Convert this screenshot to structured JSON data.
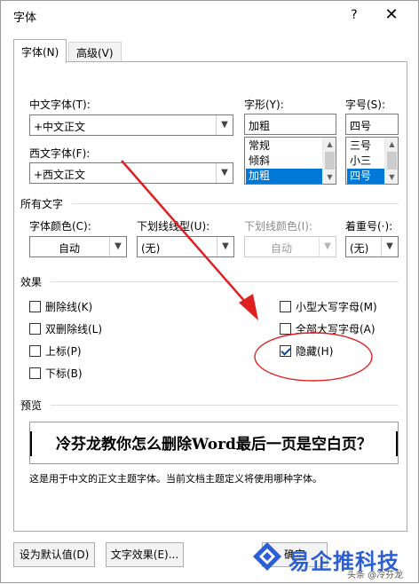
{
  "dialog": {
    "title": "字体",
    "help_glyph": "?",
    "close_glyph": "✕"
  },
  "tabs": [
    {
      "label": "字体(N)",
      "active": true
    },
    {
      "label": "高级(V)",
      "active": false
    }
  ],
  "fonts": {
    "chinese_font_label": "中文字体(T):",
    "chinese_font_value": "+中文正文",
    "western_font_label": "西文字体(F):",
    "western_font_value": "+西文正文",
    "style_label": "字形(Y):",
    "style_value": "加粗",
    "style_options": [
      "常规",
      "倾斜",
      "加粗"
    ],
    "style_selected": "加粗",
    "size_label": "字号(S):",
    "size_value": "四号",
    "size_options": [
      "三号",
      "小三",
      "四号"
    ],
    "size_selected": "四号"
  },
  "all_text": {
    "section_title": "所有文字",
    "font_color_label": "字体颜色(C):",
    "font_color_value": "自动",
    "underline_style_label": "下划线线型(U):",
    "underline_style_value": "(无)",
    "underline_color_label": "下划线颜色(I):",
    "underline_color_value": "自动",
    "emphasis_label": "着重号(·):",
    "emphasis_value": "(无)"
  },
  "effects": {
    "section_title": "效果",
    "items": [
      {
        "label": "删除线(K)",
        "checked": false
      },
      {
        "label": "双删除线(L)",
        "checked": false
      },
      {
        "label": "上标(P)",
        "checked": false
      },
      {
        "label": "下标(B)",
        "checked": false
      },
      {
        "label": "小型大写字母(M)",
        "checked": false
      },
      {
        "label": "全部大写字母(A)",
        "checked": false
      },
      {
        "label": "隐藏(H)",
        "checked": true
      }
    ]
  },
  "preview": {
    "section_title": "预览",
    "sample_text": "冷芬龙教你怎么删除Word最后一页是空白页？",
    "note": "这是用于中文的正文主题字体。当前文档主题定义将使用哪种字体。"
  },
  "footer": {
    "set_default_label": "设为默认值(D)",
    "text_effects_label": "文字效果(E)...",
    "ok_label": "确定"
  },
  "watermark": {
    "brand": "易企推科技",
    "sub": "头条 @冷芬龙"
  },
  "colors": {
    "selection": "#0078d7",
    "annotation_red": "#e02020",
    "watermark_blue": "#2a5fd6"
  }
}
